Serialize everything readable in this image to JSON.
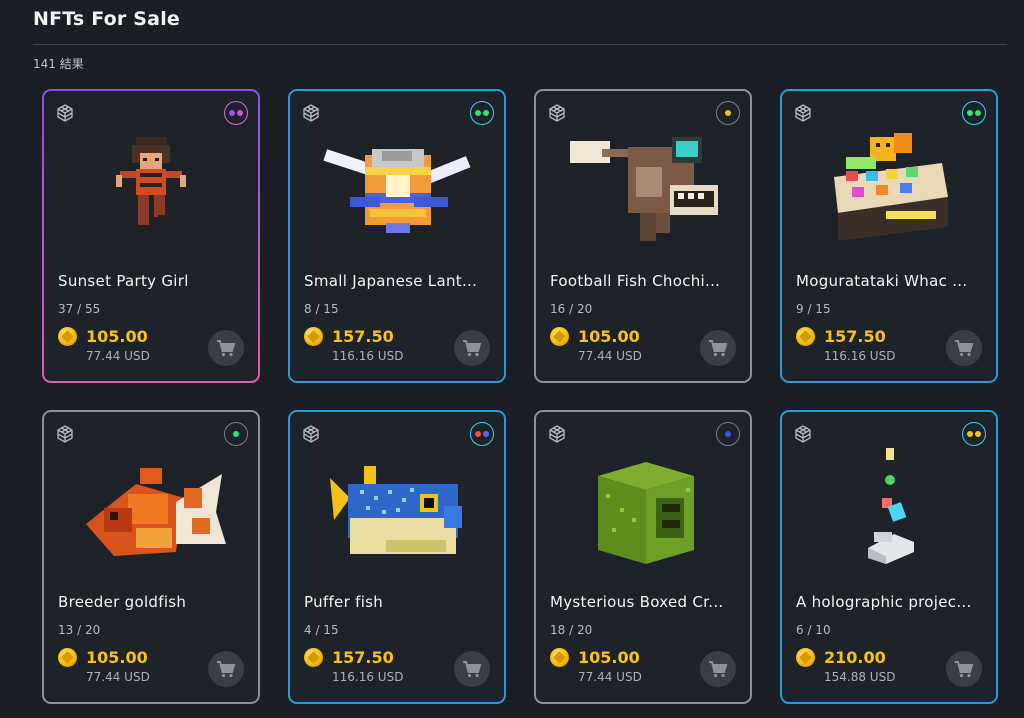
{
  "header": {
    "title": "NFTs For Sale",
    "result_count": "141 結果"
  },
  "items": [
    {
      "name": "Sunset Party Girl",
      "stock": "37 / 55",
      "price": "105.00",
      "usd": "77.44 USD",
      "frame": "purple",
      "rarity_dots": [
        "#8a5cff",
        "#e04cd0"
      ]
    },
    {
      "name": "Small Japanese Lant...",
      "stock": "8 / 15",
      "price": "157.50",
      "usd": "116.16 USD",
      "frame": "blue",
      "rarity_dots": [
        "#37e07a",
        "#37e07a"
      ]
    },
    {
      "name": "Football Fish Chochi...",
      "stock": "16 / 20",
      "price": "105.00",
      "usd": "77.44 USD",
      "frame": "gray",
      "rarity_dots": [
        "#f2c321"
      ]
    },
    {
      "name": "Moguratataki Whac ...",
      "stock": "9 / 15",
      "price": "157.50",
      "usd": "116.16 USD",
      "frame": "blue",
      "rarity_dots": [
        "#37e07a",
        "#37e07a"
      ]
    },
    {
      "name": "Breeder goldfish",
      "stock": "13 / 20",
      "price": "105.00",
      "usd": "77.44 USD",
      "frame": "gray",
      "rarity_dots": [
        "#37e07a"
      ]
    },
    {
      "name": "Puffer fish",
      "stock": "4 / 15",
      "price": "157.50",
      "usd": "116.16 USD",
      "frame": "blue",
      "rarity_dots": [
        "#f04e4e",
        "#4f6df0"
      ]
    },
    {
      "name": "Mysterious Boxed Cr...",
      "stock": "18 / 20",
      "price": "105.00",
      "usd": "77.44 USD",
      "frame": "gray",
      "rarity_dots": [
        "#3b5bf0"
      ]
    },
    {
      "name": "A holographic projec...",
      "stock": "6 / 10",
      "price": "210.00",
      "usd": "154.88 USD",
      "frame": "blue",
      "rarity_dots": [
        "#f2c321",
        "#f2c321"
      ]
    }
  ],
  "colors": {
    "accent_blue": "#2a9bd8",
    "price_gold": "#f7c21a",
    "frame_gray": "#8d9198"
  }
}
